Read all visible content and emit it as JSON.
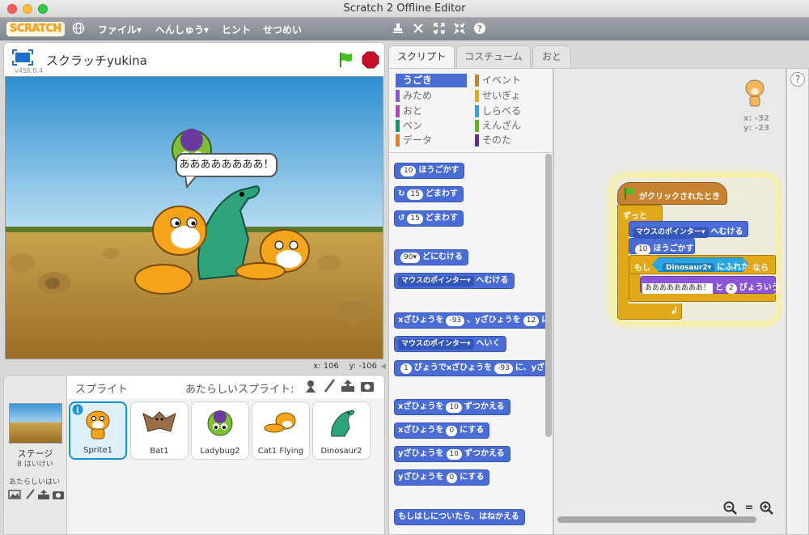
{
  "window": {
    "title": "Scratch 2 Offline Editor"
  },
  "menu": {
    "logo": "SCRATCH",
    "items": [
      "ファイル▾",
      "へんしゅう▾",
      "ヒント",
      "せつめい"
    ]
  },
  "stage": {
    "project_title": "スクラッチyukina",
    "version": "v456.0.4",
    "speech": "ああああああああ！",
    "x_label": "x:",
    "x_value": "106",
    "y_label": "y:",
    "y_value": "-106"
  },
  "sprites": {
    "header": "スプライト",
    "new_sprite": "あたらしいスプライト:",
    "stage_label": "ステージ",
    "stage_sub": "8 はいけい",
    "new_backdrop": "あたらしいはい",
    "items": [
      {
        "name": "Sprite1"
      },
      {
        "name": "Bat1"
      },
      {
        "name": "Ladybug2"
      },
      {
        "name": "Cat1 Flying"
      },
      {
        "name": "Dinosaur2"
      }
    ]
  },
  "tabs": [
    "スクリプト",
    "コスチューム",
    "おと"
  ],
  "categories": [
    {
      "label": "うごき",
      "color": "#4a6cd4",
      "selected": true
    },
    {
      "label": "みため",
      "color": "#8a55d7"
    },
    {
      "label": "おと",
      "color": "#bb42c3"
    },
    {
      "label": "ペン",
      "color": "#0e9a6c"
    },
    {
      "label": "データ",
      "color": "#ee7d16"
    },
    {
      "label": "イベント",
      "color": "#c88330"
    },
    {
      "label": "せいぎょ",
      "color": "#e1a91a"
    },
    {
      "label": "しらべる",
      "color": "#2ca5e2"
    },
    {
      "label": "えんざん",
      "color": "#5cb712"
    },
    {
      "label": "そのた",
      "color": "#632d99"
    }
  ],
  "blocks": {
    "move": {
      "value": "10",
      "text": "ほうごかす"
    },
    "turn_right": {
      "value": "15",
      "text": "どまわす"
    },
    "turn_left": {
      "value": "15",
      "text": "どまわす"
    },
    "point_dir": {
      "value": "90▾",
      "text": "どにむける"
    },
    "point_towards": {
      "menu": "マウスのポインター▾",
      "text": "へむける"
    },
    "goto_xy": {
      "a": "xざひょうを",
      "x": "-93",
      "b": "、yざひょうを",
      "y": "12",
      "c": "に"
    },
    "goto": {
      "menu": "マウスのポインター▾",
      "text": "へいく"
    },
    "glide": {
      "secs": "1",
      "a": "びょうでxざひょうを",
      "x": "-93",
      "b": "に、yざひ"
    },
    "change_x": {
      "a": "xざひょうを",
      "v": "10",
      "b": "ずつかえる"
    },
    "set_x": {
      "a": "xざひょうを",
      "v": "0",
      "b": "にする"
    },
    "change_y": {
      "a": "yざひょうを",
      "v": "10",
      "b": "ずつかえる"
    },
    "set_y": {
      "a": "yざひょうを",
      "v": "0",
      "b": "にする"
    },
    "bounce": "もしはしについたら、はねかえる"
  },
  "script": {
    "sprite_x": "x: -32",
    "sprite_y": "y: -23",
    "hat": "がクリックされたとき",
    "forever": "ずっと",
    "point_menu": "マウスのポインター▾",
    "point_text": "へむける",
    "move_value": "10",
    "move_text": "ほうごかす",
    "if": "もし",
    "touch_menu": "Dinosaur2▾",
    "touch_text": "にふれた",
    "then": "なら",
    "say_text": "ああああああああ！",
    "say_mid": "と",
    "say_secs": "2",
    "say_end": "びょういう",
    "loop_arrow": "↲"
  },
  "zoom": {
    "out": "−",
    "reset": "=",
    "in": "+"
  },
  "help_icon": "?"
}
